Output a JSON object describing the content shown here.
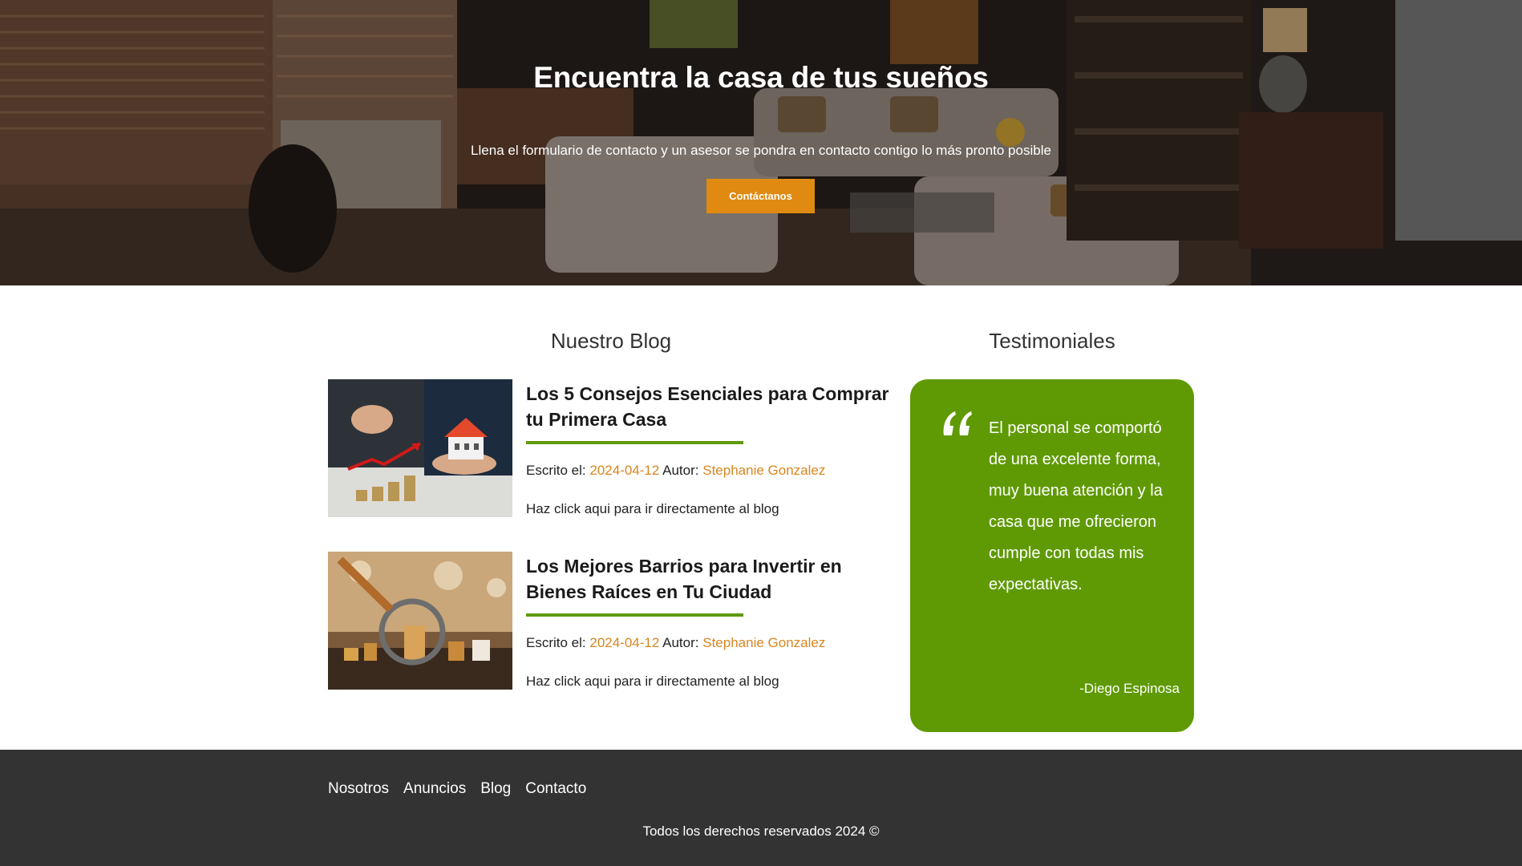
{
  "hero": {
    "title": "Encuentra la casa de tus sueños",
    "subtitle": "Llena el formulario de contacto y un asesor se pondra en contacto contigo lo más pronto posible",
    "cta_label": "Contáctanos",
    "cta_color": "#e08a12"
  },
  "blog": {
    "section_title": "Nuestro Blog",
    "posts": [
      {
        "title": "Los 5 Consejos Esenciales para Comprar tu Primera Casa",
        "written_label": "Escrito el:",
        "date": "2024-04-12",
        "author_label": "Autor:",
        "author": "Stephanie Gonzalez",
        "link_text": "Haz click aqui para ir directamente al blog"
      },
      {
        "title": "Los Mejores Barrios para Invertir en Bienes Raíces en Tu Ciudad",
        "written_label": "Escrito el:",
        "date": "2024-04-12",
        "author_label": "Autor:",
        "author": "Stephanie Gonzalez",
        "link_text": "Haz click aqui para ir directamente al blog"
      }
    ]
  },
  "testimonials": {
    "section_title": "Testimoniales",
    "quote": "El personal se comportó de una excelente forma, muy buena atención y la casa que me ofrecieron cumple con todas mis expectativas.",
    "author": "-Diego Espinosa",
    "card_color": "#5f9a04"
  },
  "footer": {
    "nav": [
      "Nosotros",
      "Anuncios",
      "Blog",
      "Contacto"
    ],
    "copyright": "Todos los derechos reservados 2024 ©"
  },
  "colors": {
    "accent_orange": "#d8861f",
    "accent_green": "#5f9a08",
    "footer_bg": "#333333"
  }
}
